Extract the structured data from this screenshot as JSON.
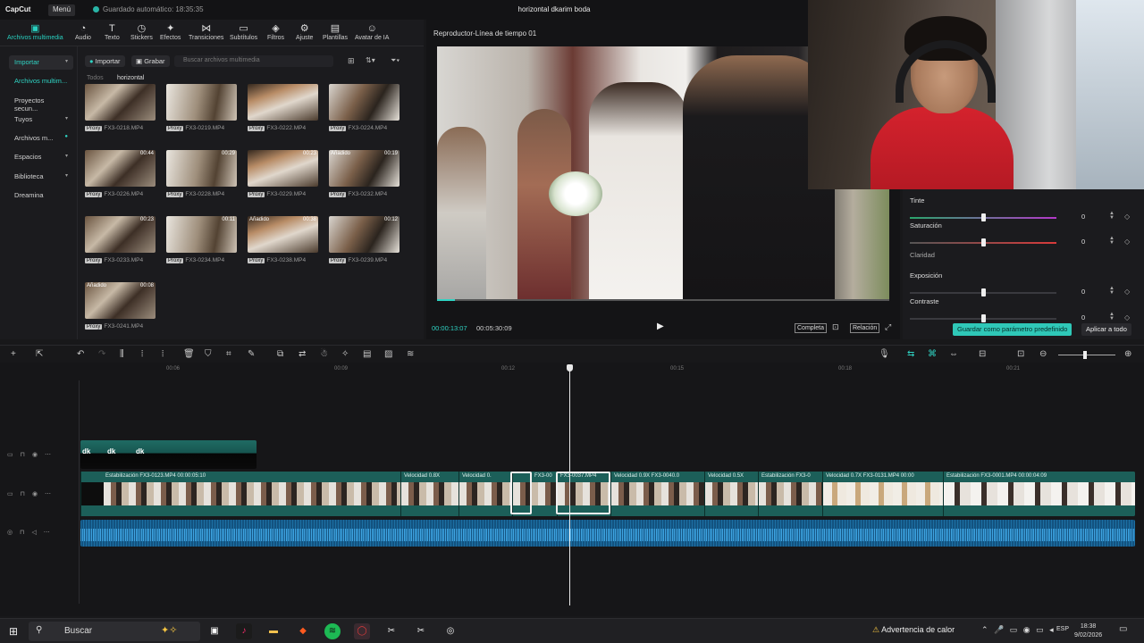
{
  "app": {
    "logo": "CapCut",
    "menu": "Menú",
    "autosave": "Guardado automático: 18:35:35",
    "project": "horizontal dkarim boda"
  },
  "toolbar": {
    "items": [
      "Archivos multimedia",
      "Audio",
      "Texto",
      "Stickers",
      "Efectos",
      "Transiciones",
      "Subtítulos",
      "Filtros",
      "Ajuste",
      "Plantillas",
      "Avatar de IA"
    ]
  },
  "sidenav": {
    "items": [
      "Importar",
      "Archivos multim...",
      "Proyectos secun...",
      "Tuyos",
      "Archivos m...",
      "Espacios",
      "Biblioteca",
      "Dreamina"
    ]
  },
  "media": {
    "import": "Importar",
    "record": "Grabar",
    "search_placeholder": "Buscar archivos multimedia",
    "filter_all": "Todos",
    "filter_folder": "horizontal",
    "proxy": "Proxy",
    "items": [
      {
        "name": "FX3-0218.MP4",
        "dur": "",
        "tag": ""
      },
      {
        "name": "FX3-0219.MP4",
        "dur": "",
        "tag": ""
      },
      {
        "name": "FX3-0222.MP4",
        "dur": "",
        "tag": ""
      },
      {
        "name": "FX3-0224.MP4",
        "dur": "",
        "tag": ""
      },
      {
        "name": "FX3-0226.MP4",
        "dur": "00:44",
        "tag": ""
      },
      {
        "name": "FX3-0228.MP4",
        "dur": "00:29",
        "tag": ""
      },
      {
        "name": "FX3-0229.MP4",
        "dur": "00:23",
        "tag": ""
      },
      {
        "name": "FX3-0232.MP4",
        "dur": "00:19",
        "tag": "Añadido"
      },
      {
        "name": "FX3-0233.MP4",
        "dur": "00:23",
        "tag": ""
      },
      {
        "name": "FX3-0234.MP4",
        "dur": "00:11",
        "tag": ""
      },
      {
        "name": "FX3-0238.MP4",
        "dur": "00:38",
        "tag": "Añadido"
      },
      {
        "name": "FX3-0239.MP4",
        "dur": "00:12",
        "tag": ""
      },
      {
        "name": "FX3-0241.MP4",
        "dur": "00:08",
        "tag": "Añadido"
      }
    ]
  },
  "player": {
    "title": "Reproductor-Línea de tiempo 01",
    "current": "00:00:13:07",
    "total": "00:05:30:09",
    "full": "Completa",
    "ratio": "Relación",
    "progress": 0.04
  },
  "adjust": {
    "rows": [
      {
        "label": "Tinte",
        "value": "0",
        "level": 0.5
      },
      {
        "label": "Saturación",
        "value": "0",
        "level": 0.5
      },
      {
        "label": "Claridad",
        "value": "",
        "level": null
      },
      {
        "label": "Exposición",
        "value": "0",
        "level": 0.5
      },
      {
        "label": "Contraste",
        "value": "0",
        "level": 0.5
      }
    ],
    "save": "Guardar como parámetro predefinido",
    "apply": "Aplicar a todo"
  },
  "ruler": [
    "00:06",
    "00:09",
    "00:12",
    "00:15",
    "00:18",
    "00:21"
  ],
  "clips": [
    {
      "label": "Estabilización  FX3-0123.MP4  00:00:05:10"
    },
    {
      "label": "Velocidad 0.8X"
    },
    {
      "label": "Velocidad 0."
    },
    {
      "label": "FX3-00"
    },
    {
      "label": "FX3-0037.MP4"
    },
    {
      "label": "Velocidad 0.9X  FX3-0040.0"
    },
    {
      "label": "Velocidad 0.5X"
    },
    {
      "label": "Estabilización  FX3-0"
    },
    {
      "label": "Velocidad 0.7X  FX3-0131.MP4  00:00"
    },
    {
      "label": "Estabilización  FX3-0001.MP4  00:00:04:09"
    }
  ],
  "text_clips": [
    "dk",
    "dk",
    "dk"
  ],
  "taskbar": {
    "search": "Buscar",
    "warning": "Advertencia de calor",
    "lang": "ESP",
    "time": "18:38",
    "date": "9/02/2026"
  }
}
